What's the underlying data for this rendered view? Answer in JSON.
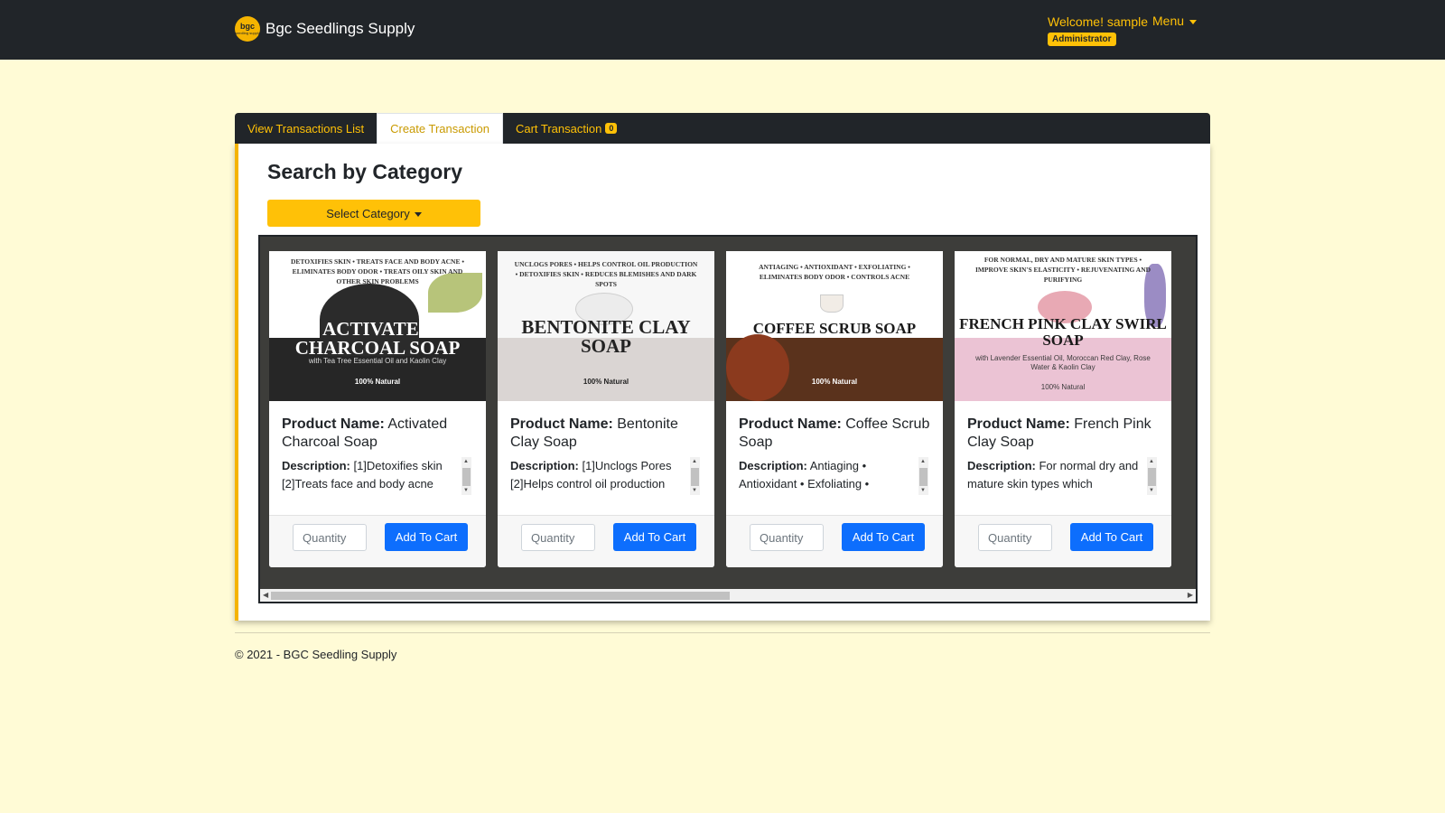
{
  "navbar": {
    "logo_text": "bgc",
    "logo_subtext": "seedling supply",
    "brand": "Bgc Seedlings Supply",
    "welcome": "Welcome! sample",
    "menu_label": "Menu",
    "role_badge": "Administrator",
    "accent_color": "#ffc107"
  },
  "tabs": [
    {
      "label": "View Transactions List",
      "active": false
    },
    {
      "label": "Create Transaction",
      "active": true
    },
    {
      "label": "Cart Transaction",
      "active": false,
      "badge": "0"
    }
  ],
  "main": {
    "section_title": "Search by Category",
    "select_category_label": "Select Category",
    "name_label": "Product Name:",
    "desc_label": "Description:",
    "quantity_placeholder": "Quantity",
    "add_to_cart_label": "Add To Cart",
    "products": [
      {
        "name": "Activated Charcoal Soap",
        "description": "[1]Detoxifies skin [2]Treats face and body acne",
        "image": {
          "tagline": "DETOXIFIES SKIN • TREATS FACE AND BODY ACNE • ELIMINATES BODY ODOR • TREATS OILY SKIN AND OTHER SKIN PROBLEMS",
          "title": "ACTIVATED CHARCOAL SOAP",
          "subtitle": "with Tea Tree Essential Oil and Kaolin Clay",
          "natural": "100% Natural",
          "band_color": "#262626"
        }
      },
      {
        "name": "Bentonite Clay Soap",
        "description": "[1]Unclogs Pores [2]Helps control oil production",
        "image": {
          "tagline": "UNCLOGS PORES • HELPS CONTROL OIL PRODUCTION • DETOXIFIES SKIN • REDUCES BLEMISHES AND DARK SPOTS",
          "title": "BENTONITE CLAY SOAP",
          "subtitle": "",
          "natural": "100% Natural",
          "band_color": "#dad5d3"
        }
      },
      {
        "name": "Coffee Scrub Soap",
        "description": "Antiaging • Antioxidant • Exfoliating •",
        "image": {
          "tagline": "ANTIAGING • ANTIOXIDANT • EXFOLIATING • ELIMINATES BODY ODOR • CONTROLS ACNE",
          "title": "COFFEE SCRUB SOAP",
          "subtitle": "",
          "natural": "100% Natural",
          "band_color": "#5a321c"
        }
      },
      {
        "name": "French Pink Clay Soap",
        "description": "For normal dry and mature skin types which",
        "image": {
          "tagline": "FOR NORMAL, DRY AND MATURE SKIN TYPES • IMPROVE SKIN'S ELASTICITY • REJUVENATING AND PURIFYING",
          "title": "FRENCH PINK CLAY SWIRL SOAP",
          "subtitle": "with Lavender Essential Oil, Moroccan Red Clay, Rose Water & Kaolin Clay",
          "natural": "100% Natural",
          "band_color": "#ebc3d4"
        }
      }
    ]
  },
  "footer": {
    "text": "© 2021 - BGC Seedling Supply"
  }
}
